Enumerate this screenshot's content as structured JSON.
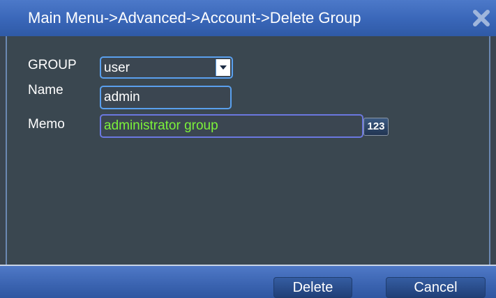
{
  "window": {
    "title": "Main Menu->Advanced->Account->Delete Group",
    "close_icon": "close-icon"
  },
  "form": {
    "group_label": "GROUP",
    "group_value": "user",
    "name_label": "Name",
    "name_value": "admin",
    "memo_label": "Memo",
    "memo_value": "administrator group",
    "keyboard_label": "123"
  },
  "footer": {
    "delete_label": "Delete",
    "cancel_label": "Cancel"
  },
  "colors": {
    "title_bar": "#3966b8",
    "panel_bg": "#3a4750",
    "memo_text": "#7cf23a",
    "field_border": "#5aa0ee"
  }
}
